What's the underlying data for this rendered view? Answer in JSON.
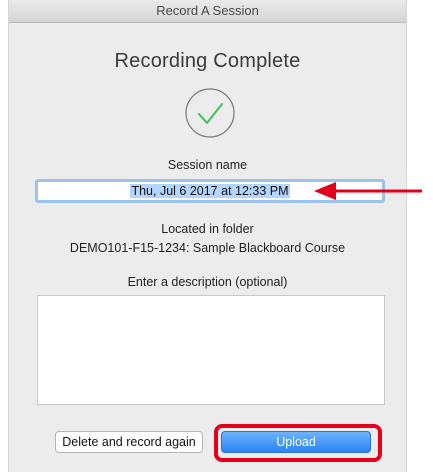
{
  "window": {
    "title": "Record A Session"
  },
  "main": {
    "heading": "Recording Complete",
    "session_name_label": "Session name",
    "session_name_value": "Thu, Jul 6 2017 at 12:33 PM",
    "folder_label": "Located in folder",
    "folder_value": "DEMO101-F15-1234: Sample Blackboard Course",
    "description_label": "Enter a description (optional)",
    "description_value": ""
  },
  "buttons": {
    "delete_label": "Delete and record again",
    "upload_label": "Upload"
  },
  "colors": {
    "annotation": "#e3001b",
    "check": "#3fbf5f",
    "primary": "#2a84f6"
  },
  "icons": {
    "status": "checkmark-circle-icon",
    "annotation_arrow": "arrow-left-icon"
  }
}
